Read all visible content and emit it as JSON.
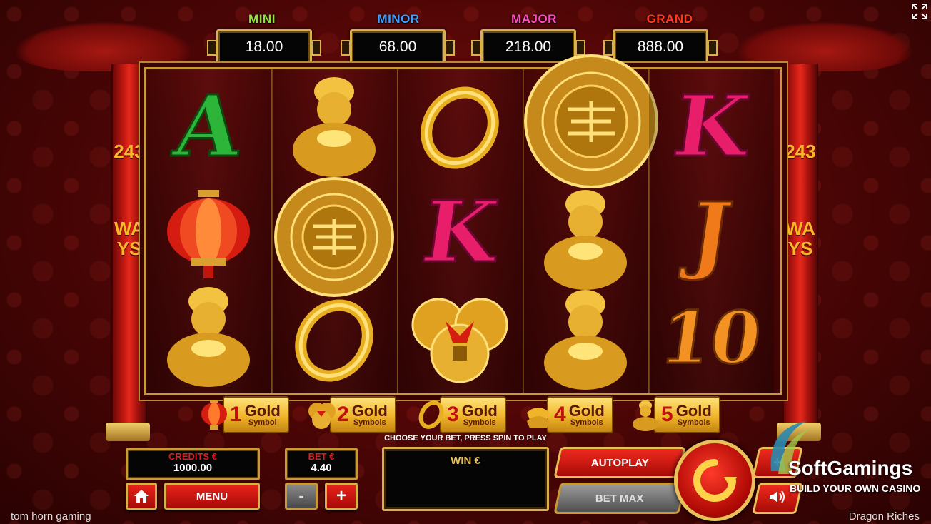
{
  "jackpots": [
    {
      "label": "MINI",
      "value": "18.00",
      "color": "#8fe23a"
    },
    {
      "label": "MINOR",
      "value": "68.00",
      "color": "#3fa0ff"
    },
    {
      "label": "MAJOR",
      "value": "218.00",
      "color": "#ff4fc1"
    },
    {
      "label": "GRAND",
      "value": "888.00",
      "color": "#ff3b1f"
    }
  ],
  "side_text": {
    "left_number": "243",
    "left_word": "WAYS",
    "right_number": "243",
    "right_word": "WAYS"
  },
  "reels": [
    [
      "letter-A",
      "lantern",
      "gold-god"
    ],
    [
      "gold-god",
      "gold-medallion",
      "gold-ring"
    ],
    [
      "gold-ring",
      "letter-K",
      "gold-coins"
    ],
    [
      "gold-medallion",
      "gold-god",
      "gold-god"
    ],
    [
      "letter-K",
      "letter-J",
      "letter-10"
    ]
  ],
  "symbols": {
    "A": "A",
    "K": "K",
    "J": "J",
    "ten": "10"
  },
  "gold_symbols": [
    {
      "icon": "lantern",
      "num": "1",
      "gold": "Gold",
      "unit": "Symbol"
    },
    {
      "icon": "coins",
      "num": "2",
      "gold": "Gold",
      "unit": "Symbols"
    },
    {
      "icon": "ring",
      "num": "3",
      "gold": "Gold",
      "unit": "Symbols"
    },
    {
      "icon": "ingots",
      "num": "4",
      "gold": "Gold",
      "unit": "Symbols"
    },
    {
      "icon": "gold-god",
      "num": "5",
      "gold": "Gold",
      "unit": "Symbols"
    }
  ],
  "controls": {
    "credits_label": "CREDITS €",
    "credits_value": "1000.00",
    "bet_label": "BET €",
    "bet_value": "4.40",
    "menu": "MENU",
    "minus": "-",
    "plus": "+",
    "instructions": "CHOOSE YOUR BET, PRESS SPIN TO PLAY",
    "win_label": "WIN €",
    "autoplay": "AUTOPLAY",
    "bet_max": "BET MAX"
  },
  "footer": {
    "left": "tom horn gaming",
    "right": "Dragon Riches"
  },
  "watermark": {
    "brand": "SoftGamings",
    "tagline": "BUILD YOUR OWN CASINO"
  },
  "colors": {
    "gold": "#d9b04a",
    "red": "#e8231b",
    "bg": "#4a0505"
  }
}
